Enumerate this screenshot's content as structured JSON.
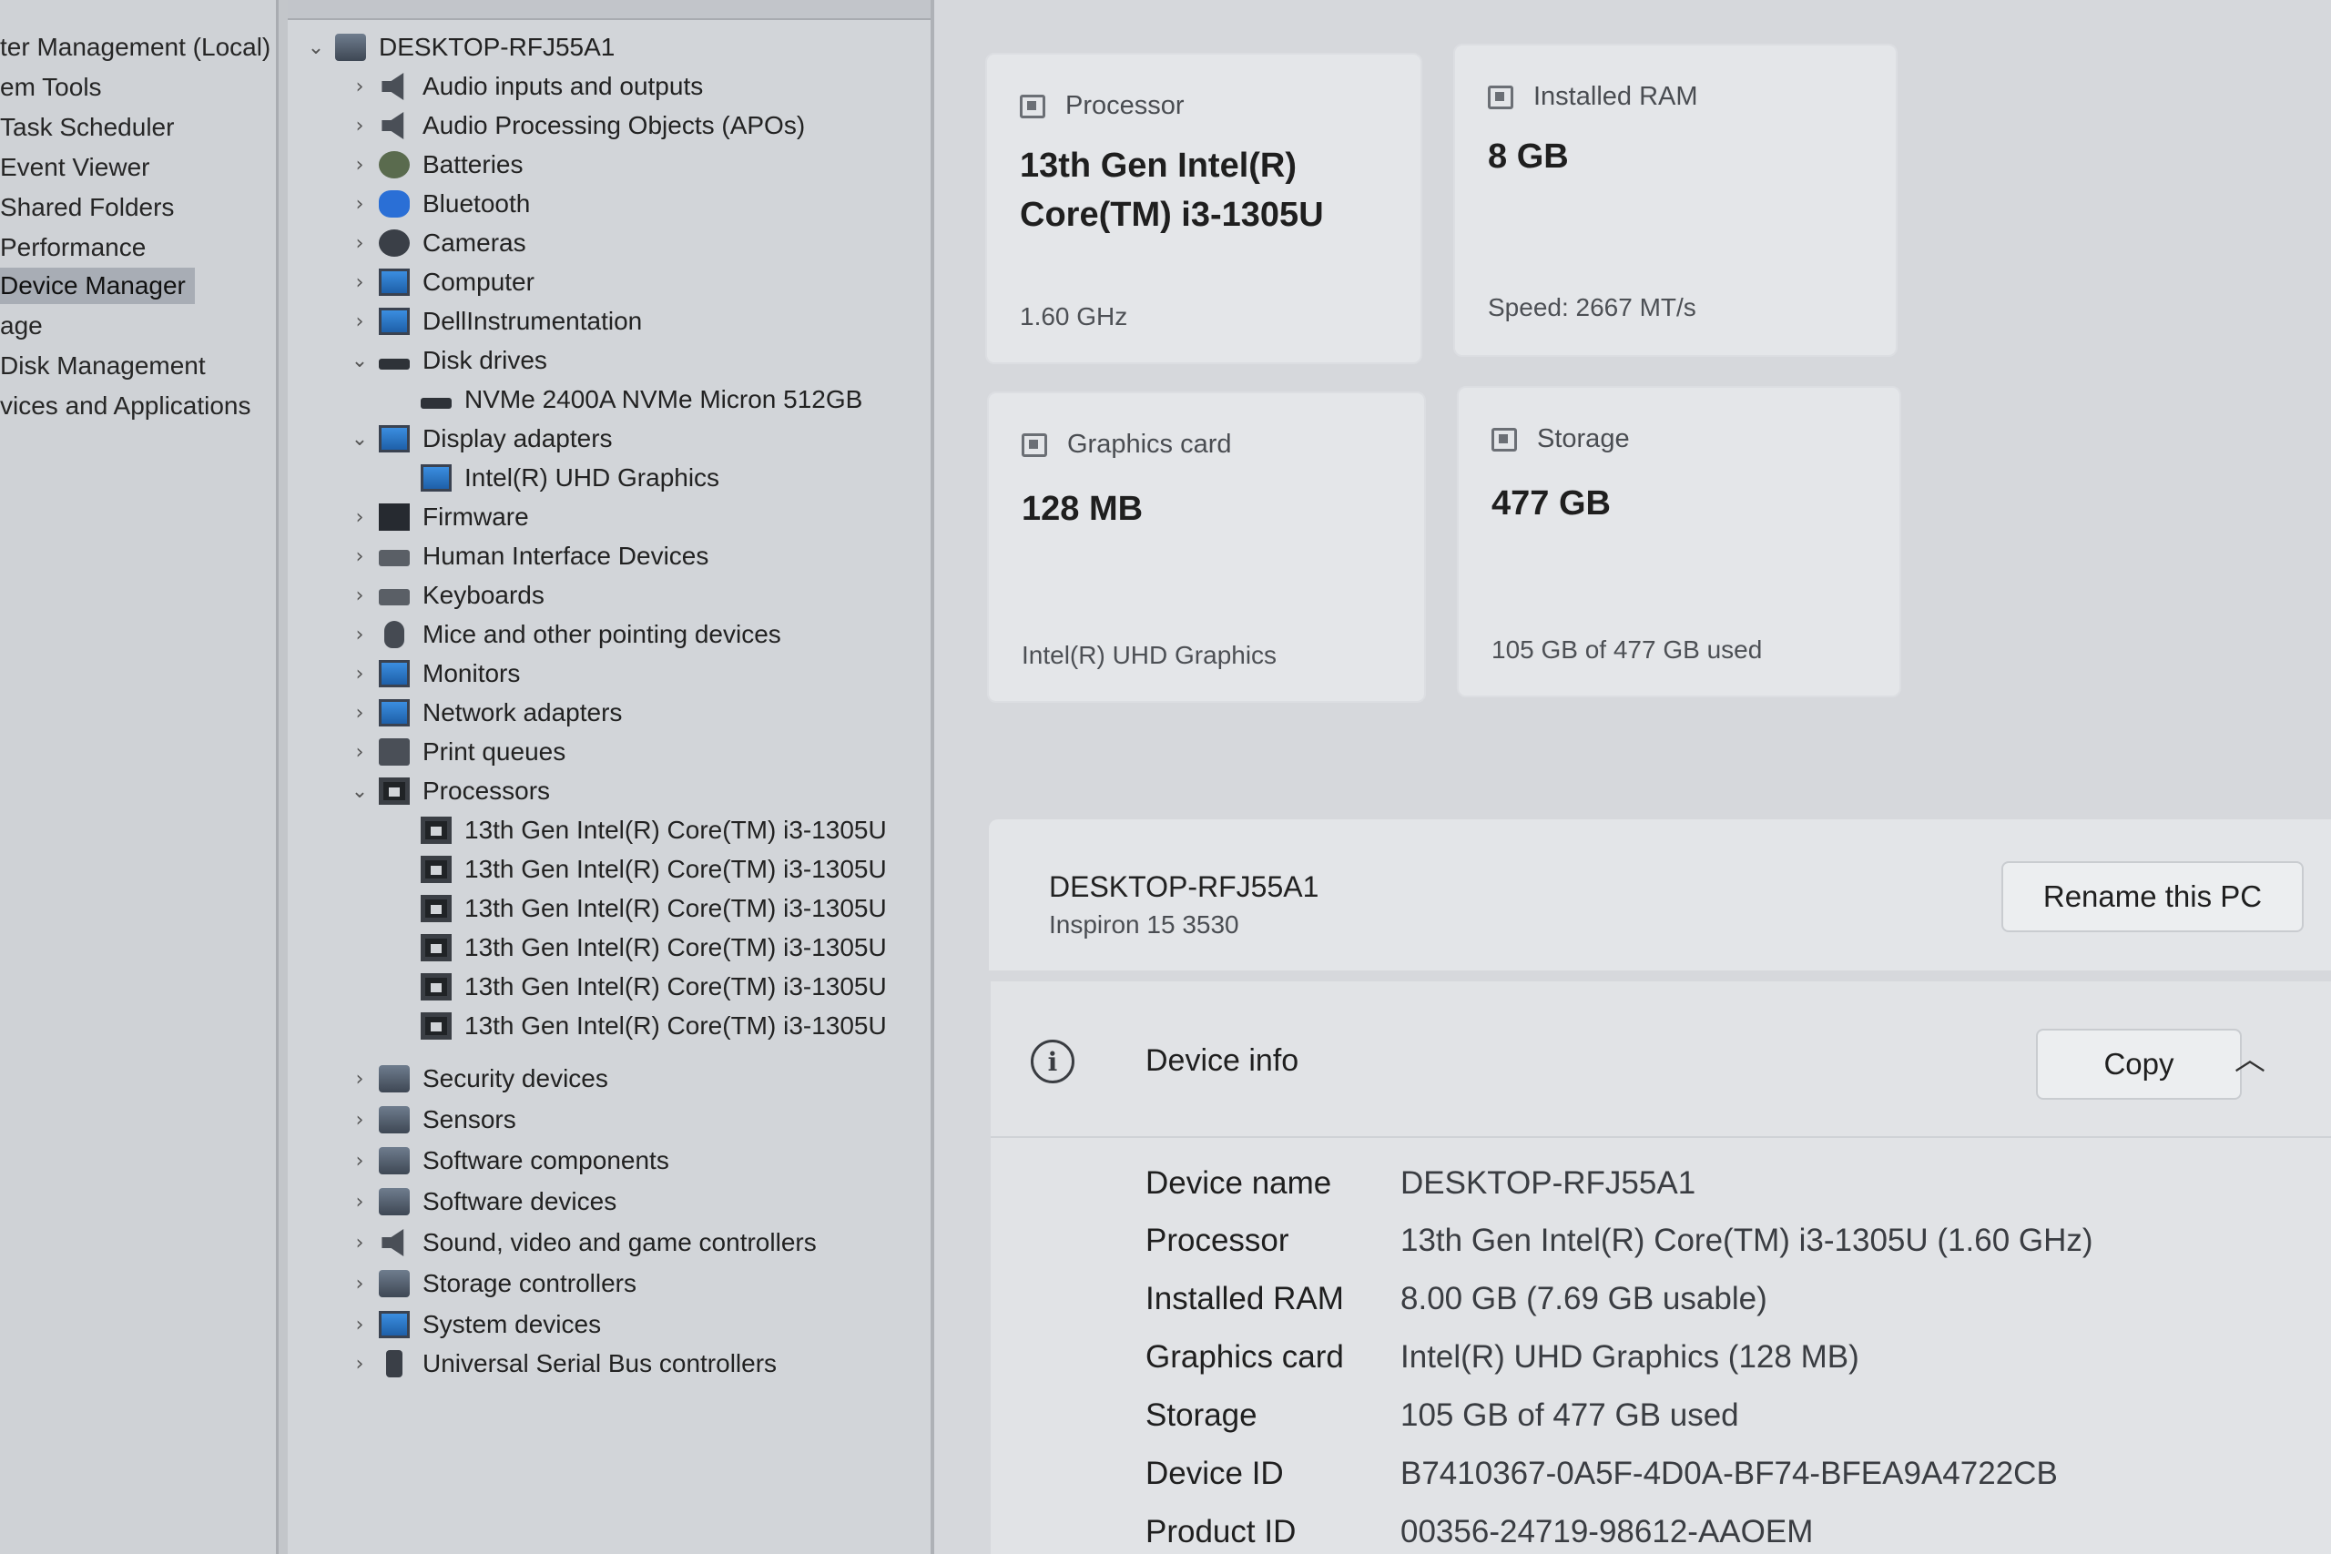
{
  "console_tree": {
    "items": [
      {
        "label": "ter Management (Local)",
        "selected": false
      },
      {
        "label": "em Tools",
        "selected": false
      },
      {
        "label": "Task Scheduler",
        "selected": false
      },
      {
        "label": "Event Viewer",
        "selected": false
      },
      {
        "label": "Shared Folders",
        "selected": false
      },
      {
        "label": "Performance",
        "selected": false
      },
      {
        "label": "Device Manager",
        "selected": true
      },
      {
        "label": "age",
        "selected": false
      },
      {
        "label": "Disk Management",
        "selected": false
      },
      {
        "label": "vices and Applications",
        "selected": false
      }
    ]
  },
  "device_tree": {
    "root": {
      "label": "DESKTOP-RFJ55A1",
      "icon": "computer-icon",
      "expanded": true
    },
    "categories": [
      {
        "label": "Audio inputs and outputs",
        "icon": "speaker-icon",
        "expanded": false
      },
      {
        "label": "Audio Processing Objects (APOs)",
        "icon": "speaker-icon",
        "expanded": false
      },
      {
        "label": "Batteries",
        "icon": "battery-icon",
        "expanded": false
      },
      {
        "label": "Bluetooth",
        "icon": "bluetooth-icon",
        "expanded": false
      },
      {
        "label": "Cameras",
        "icon": "camera-icon",
        "expanded": false
      },
      {
        "label": "Computer",
        "icon": "monitor-icon",
        "expanded": false
      },
      {
        "label": "DellInstrumentation",
        "icon": "monitor-icon",
        "expanded": false
      },
      {
        "label": "Disk drives",
        "icon": "disk-icon",
        "expanded": true,
        "children": [
          "NVMe 2400A NVMe Micron 512GB"
        ]
      },
      {
        "label": "Display adapters",
        "icon": "monitor-icon",
        "expanded": true,
        "children": [
          "Intel(R) UHD Graphics"
        ]
      },
      {
        "label": "Firmware",
        "icon": "firmware-icon",
        "expanded": false
      },
      {
        "label": "Human Interface Devices",
        "icon": "hid-icon",
        "expanded": false
      },
      {
        "label": "Keyboards",
        "icon": "keyboard-icon",
        "expanded": false
      },
      {
        "label": "Mice and other pointing devices",
        "icon": "mouse-icon",
        "expanded": false
      },
      {
        "label": "Monitors",
        "icon": "monitor-icon",
        "expanded": false
      },
      {
        "label": "Network adapters",
        "icon": "network-icon",
        "expanded": false
      },
      {
        "label": "Print queues",
        "icon": "printer-icon",
        "expanded": false
      },
      {
        "label": "Processors",
        "icon": "chip-icon",
        "expanded": true,
        "children": [
          "13th Gen Intel(R) Core(TM) i3-1305U",
          "13th Gen Intel(R) Core(TM) i3-1305U",
          "13th Gen Intel(R) Core(TM) i3-1305U",
          "13th Gen Intel(R) Core(TM) i3-1305U",
          "13th Gen Intel(R) Core(TM) i3-1305U",
          "13th Gen Intel(R) Core(TM) i3-1305U"
        ]
      },
      {
        "label": "Security devices",
        "icon": "security-icon",
        "expanded": false
      },
      {
        "label": "Sensors",
        "icon": "sensor-icon",
        "expanded": false
      },
      {
        "label": "Software components",
        "icon": "software-component-icon",
        "expanded": false
      },
      {
        "label": "Software devices",
        "icon": "software-device-icon",
        "expanded": false
      },
      {
        "label": "Sound, video and game controllers",
        "icon": "speaker-icon",
        "expanded": false
      },
      {
        "label": "Storage controllers",
        "icon": "storage-controller-icon",
        "expanded": false
      },
      {
        "label": "System devices",
        "icon": "system-icon",
        "expanded": false
      },
      {
        "label": "Universal Serial Bus controllers",
        "icon": "usb-icon",
        "expanded": false
      }
    ]
  },
  "specs": {
    "processor": {
      "title": "Processor",
      "value": "13th Gen Intel(R) Core(TM) i3-1305U",
      "sub": "1.60 GHz"
    },
    "ram": {
      "title": "Installed RAM",
      "value": "8 GB",
      "sub": "Speed: 2667 MT/s"
    },
    "graphics": {
      "title": "Graphics card",
      "value": "128 MB",
      "sub": "Intel(R) UHD Graphics"
    },
    "storage": {
      "title": "Storage",
      "value": "477 GB",
      "sub": "105 GB of 477 GB used"
    }
  },
  "pc": {
    "name": "DESKTOP-RFJ55A1",
    "model": "Inspiron 15 3530",
    "rename_label": "Rename this PC"
  },
  "device_info": {
    "title": "Device info",
    "copy_label": "Copy",
    "rows": [
      {
        "label": "Device name",
        "value": "DESKTOP-RFJ55A1"
      },
      {
        "label": "Processor",
        "value": "13th Gen Intel(R) Core(TM) i3-1305U (1.60 GHz)"
      },
      {
        "label": "Installed RAM",
        "value": "8.00 GB (7.69 GB usable)"
      },
      {
        "label": "Graphics card",
        "value": "Intel(R) UHD Graphics (128 MB)"
      },
      {
        "label": "Storage",
        "value": "105 GB of 477 GB used"
      },
      {
        "label": "Device ID",
        "value": "B7410367-0A5F-4D0A-BF74-BFEA9A4722CB"
      },
      {
        "label": "Product ID",
        "value": "00356-24719-98612-AAOEM"
      }
    ]
  }
}
